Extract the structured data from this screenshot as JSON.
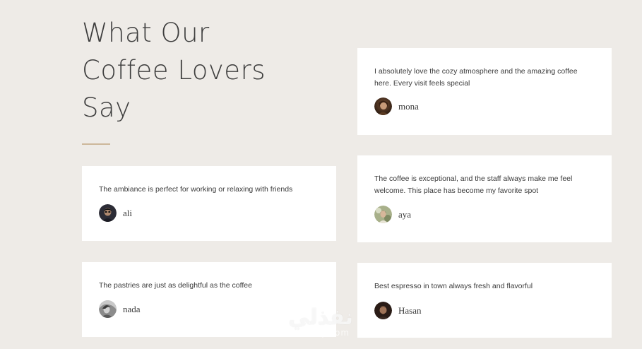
{
  "section": {
    "title_lines": [
      "What Our",
      "Coffee Lovers",
      "Say"
    ]
  },
  "testimonials": [
    {
      "quote": "I absolutely love the cozy atmosphere and the amazing coffee here. Every visit feels special",
      "name": "mona",
      "avatar_icon": "person-photo-icon",
      "avatar_colors": [
        "#5a3a22",
        "#2a1a10"
      ]
    },
    {
      "quote": "The ambiance is perfect for working or relaxing with friends",
      "name": "ali",
      "avatar_icon": "person-photo-icon",
      "avatar_colors": [
        "#3a3a48",
        "#1a1a22"
      ]
    },
    {
      "quote": "The coffee is exceptional, and the staff always make me feel welcome. This place has become my favorite spot",
      "name": "aya",
      "avatar_icon": "person-photo-icon",
      "avatar_colors": [
        "#b9c09a",
        "#6f7a58"
      ]
    },
    {
      "quote": "The pastries are just as delightful as the coffee",
      "name": "nada",
      "avatar_icon": "person-photo-icon",
      "avatar_colors": [
        "#9a9a9a",
        "#4a4a4a"
      ]
    },
    {
      "quote": "Best espresso in town always fresh and flavorful",
      "name": "Hasan",
      "avatar_icon": "person-photo-icon",
      "avatar_colors": [
        "#4a3228",
        "#1e1410"
      ]
    }
  ],
  "watermark": {
    "arabic": "نفذلي",
    "latin": "nafezly.com"
  },
  "colors": {
    "background": "#eeebe7",
    "card": "#ffffff",
    "divider": "#cdb89b",
    "heading": "#3e3e3e"
  }
}
